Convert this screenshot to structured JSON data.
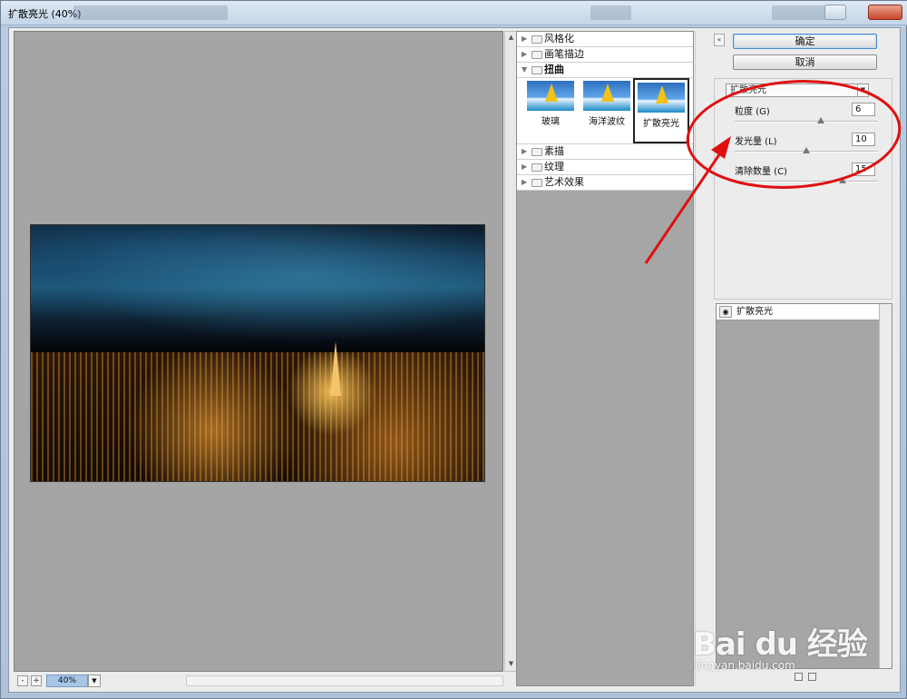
{
  "window": {
    "title": "扩散亮光 (40%)"
  },
  "preview": {
    "zoom": "40%",
    "zoom_out": "-",
    "zoom_in": "+"
  },
  "gallery": {
    "categories_top": [
      {
        "label": "风格化",
        "expanded": false
      },
      {
        "label": "画笔描边",
        "expanded": false
      },
      {
        "label": "扭曲",
        "expanded": true
      }
    ],
    "thumbnails": [
      {
        "label": "玻璃",
        "selected": false
      },
      {
        "label": "海洋波纹",
        "selected": false
      },
      {
        "label": "扩散亮光",
        "selected": true
      }
    ],
    "categories_bottom": [
      {
        "label": "素描"
      },
      {
        "label": "纹理"
      },
      {
        "label": "艺术效果"
      }
    ]
  },
  "buttons": {
    "ok": "确定",
    "cancel": "取消"
  },
  "settings": {
    "selected_filter": "扩散亮光",
    "params": [
      {
        "label": "粒度 (G)",
        "value": "6",
        "level": 0.6
      },
      {
        "label": "发光量 (L)",
        "value": "10",
        "level": 0.5
      },
      {
        "label": "清除数量 (C)",
        "value": "15",
        "level": 0.75
      }
    ]
  },
  "layers": {
    "items": [
      "扩散亮光"
    ]
  },
  "watermark": {
    "brand": "Bai du 经验",
    "sub": "jingyan.baidu.com"
  },
  "colors": {
    "annotation": "#e01010",
    "accent": "#4c8bd0"
  }
}
